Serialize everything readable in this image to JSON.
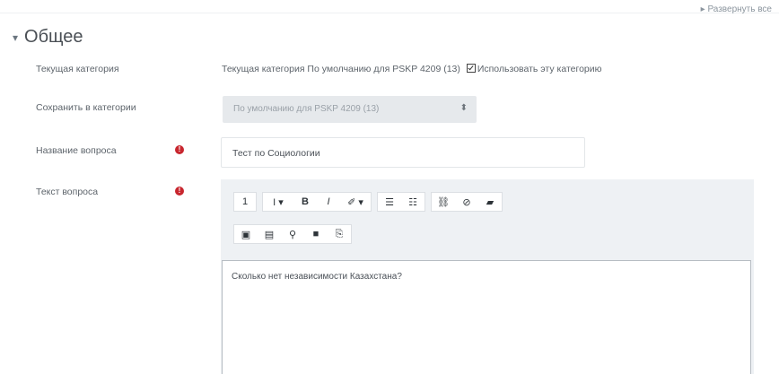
{
  "header": {
    "expand_all": "▸ Развернуть все",
    "section_caret": "▾",
    "section_title": "Общее"
  },
  "rows": {
    "current_category_label": "Текущая категория",
    "save_category_label": "Сохранить в категории",
    "question_name_label": "Название вопроса",
    "question_text_label": "Текст вопроса"
  },
  "category": {
    "text": "Текущая категория  По умолчанию для PSKP 4209 (13)",
    "use_label": "Использовать эту категорию",
    "checked": true
  },
  "save_select": {
    "value": "По умолчанию для PSKP 4209 (13)",
    "arrow": "⬍"
  },
  "question_name": {
    "value": "Тест по Социологии"
  },
  "required_glyph": "!",
  "editor": {
    "toolbar_row1": [
      "1",
      "I ▾",
      "B",
      "I",
      "✐ ▾",
      "☰",
      "☷",
      "⛓",
      "⊘",
      "▰"
    ],
    "toolbar_row2": [
      "▣",
      "▤",
      "⚲",
      "■",
      "⎘"
    ],
    "content_text": "Сколько нет независимости Казахстана?"
  },
  "colors": {
    "required": "#c8262e",
    "editor_bg": "#eef1f4",
    "select_bg": "#e6e9ec"
  }
}
